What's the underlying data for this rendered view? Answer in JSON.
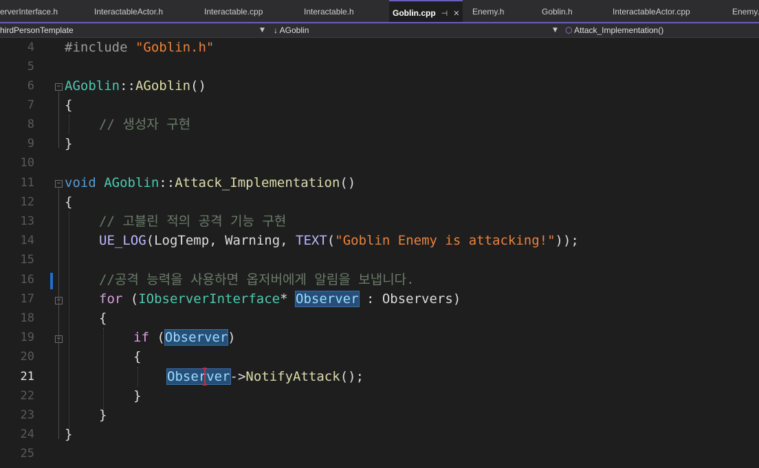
{
  "tabs": [
    {
      "label": "erverInterface.h"
    },
    {
      "label": "InteractableActor.h"
    },
    {
      "label": "Interactable.cpp"
    },
    {
      "label": "Interactable.h"
    },
    {
      "label": "Goblin.cpp",
      "active": true
    },
    {
      "label": "Enemy.h"
    },
    {
      "label": "Goblin.h"
    },
    {
      "label": "InteractableActor.cpp"
    },
    {
      "label": "Enemy.h"
    }
  ],
  "navigation": {
    "project": "hirdPersonTemplate",
    "scope": "AGoblin",
    "member": "Attack_Implementation()"
  },
  "line_numbers": [
    "4",
    "5",
    "6",
    "7",
    "8",
    "9",
    "10",
    "11",
    "12",
    "13",
    "14",
    "15",
    "16",
    "17",
    "18",
    "19",
    "20",
    "21",
    "22",
    "23",
    "24",
    "25"
  ],
  "current_line": "21",
  "code": {
    "l4_directive": "#include",
    "l4_path": "\"Goblin.h\"",
    "l6_class": "AGoblin",
    "l6_sep": "::",
    "l6_ctor": "AGoblin",
    "l6_parens": "()",
    "open_brace": "{",
    "close_brace": "}",
    "l8_comment": "// 생성자 구현",
    "l11_void": "void",
    "l11_class": "AGoblin",
    "l11_sep": "::",
    "l11_func": "Attack_Implementation",
    "l11_parens": "()",
    "l13_comment": "// 고블린 적의 공격 기능 구현",
    "l14_macro": "UE_LOG",
    "l14_paren_open": "(",
    "l14_category": "LogTemp",
    "l14_comma1": ", ",
    "l14_verbosity": "Warning",
    "l14_comma2": ", ",
    "l14_text_macro": "TEXT",
    "l14_paren_open2": "(",
    "l14_string": "\"Goblin Enemy is attacking!\"",
    "l14_end": "));",
    "l16_comment": "//공격 능력을 사용하면 옵저버에게 알림을 보냅니다.",
    "l17_for": "for",
    "l17_open": " (",
    "l17_type": "IObserverInterface",
    "l17_star": "* ",
    "l17_var": "Observer",
    "l17_colon": " : ",
    "l17_container": "Observers",
    "l17_close": ")",
    "l19_if": "if",
    "l19_open": " (",
    "l19_var": "Observer",
    "l19_close": ")",
    "l21_var": "Observer",
    "l21_arrow": "->",
    "l21_method": "NotifyAttack",
    "l21_end": "();"
  }
}
